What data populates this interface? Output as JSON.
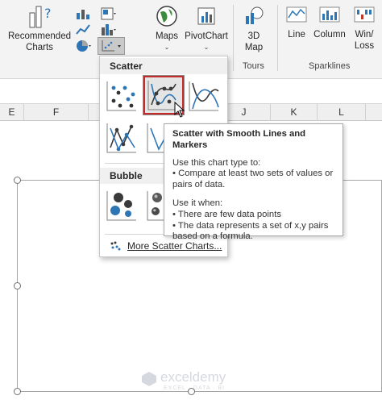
{
  "ribbon": {
    "recommended_charts": {
      "line1": "Recommended",
      "line2": "Charts"
    },
    "maps": {
      "label": "Maps"
    },
    "pivotchart": {
      "label": "PivotChart"
    },
    "map3d": {
      "line1": "3D",
      "line2": "Map"
    },
    "tours_group": "Tours",
    "line": {
      "label": "Line"
    },
    "column": {
      "label": "Column"
    },
    "winloss": {
      "line1": "Win/",
      "line2": "Loss"
    },
    "sparklines_group": "Sparklines"
  },
  "columns": [
    "E",
    "F",
    "J",
    "K",
    "L"
  ],
  "dropdown": {
    "scatter_heading": "Scatter",
    "bubble_heading": "Bubble",
    "more_label": "More Scatter Charts..."
  },
  "tooltip": {
    "title": "Scatter with Smooth Lines and Markers",
    "intro": "Use this chart type to:",
    "bullet1a": "• Compare at least two sets of values or",
    "bullet1b": "pairs of data.",
    "when": "Use it when:",
    "bullet2": "• There are few data points",
    "bullet3a": "• The data represents a set of x,y pairs",
    "bullet3b": "based on a formula."
  },
  "watermark": {
    "name": "exceldemy",
    "tagline": "EXCEL · DATA · BI"
  },
  "colors": {
    "accent_blue": "#2e75b6",
    "selection_red": "#c42b2b",
    "ribbon_bg": "#f3f3f3"
  }
}
